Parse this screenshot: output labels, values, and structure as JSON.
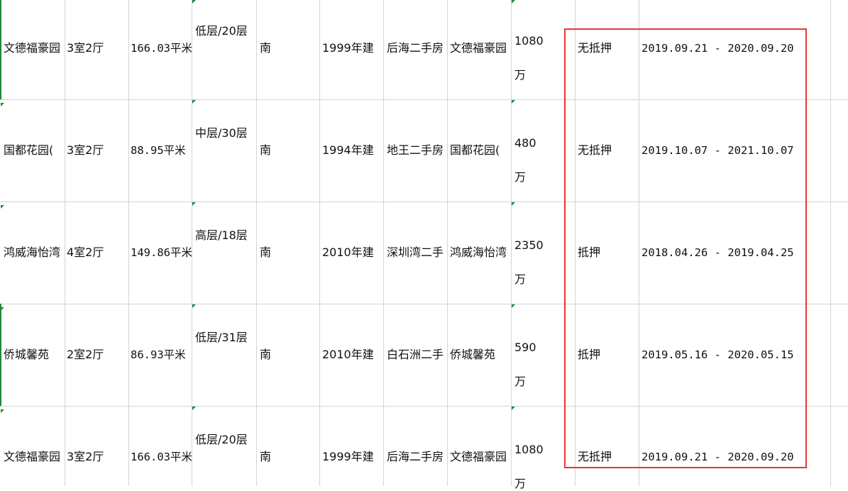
{
  "sheet": {
    "rows": [
      {
        "community": "文德福豪园",
        "layout": "3室2厅",
        "area": "166.03平米",
        "floor": "低层/20层",
        "orientation": "南",
        "built": "1999年建",
        "district": "后海二手房",
        "name": "文德福豪园",
        "price_num": "1080",
        "price_unit": "万",
        "mortgage": "无抵押",
        "period": "2019.09.21 - 2020.09.20"
      },
      {
        "community": "国都花园(",
        "layout": "3室2厅",
        "area": "88.95平米",
        "floor": "中层/30层",
        "orientation": "南",
        "built": "1994年建",
        "district": "地王二手房",
        "name": "国都花园(",
        "price_num": "480",
        "price_unit": "万",
        "mortgage": "无抵押",
        "period": "2019.10.07 - 2021.10.07"
      },
      {
        "community": "鸿威海怡湾",
        "layout": "4室2厅",
        "area": "149.86平米",
        "floor": "高层/18层",
        "orientation": "南",
        "built": "2010年建",
        "district": "深圳湾二手",
        "name": "鸿威海怡湾",
        "price_num": "2350",
        "price_unit": "万",
        "mortgage": "抵押",
        "period": "2018.04.26 - 2019.04.25"
      },
      {
        "community": "侨城馨苑",
        "layout": "2室2厅",
        "area": "86.93平米",
        "floor": "低层/31层",
        "orientation": "南",
        "built": "2010年建",
        "district": "白石洲二手",
        "name": "侨城馨苑",
        "price_num": "590",
        "price_unit": "万",
        "mortgage": "抵押",
        "period": "2019.05.16 - 2020.05.15"
      },
      {
        "community": "文德福豪园",
        "layout": "3室2厅",
        "area": "166.03平米",
        "floor": "低层/20层",
        "orientation": "南",
        "built": "1999年建",
        "district": "后海二手房",
        "name": "文德福豪园",
        "price_num": "1080",
        "price_unit": "万",
        "mortgage": "无抵押",
        "period": "2019.09.21 - 2020.09.20"
      }
    ]
  },
  "colors": {
    "grid": "#d4d4d4",
    "highlight": "#e53935",
    "cell_marker": "#1e8a3a"
  }
}
